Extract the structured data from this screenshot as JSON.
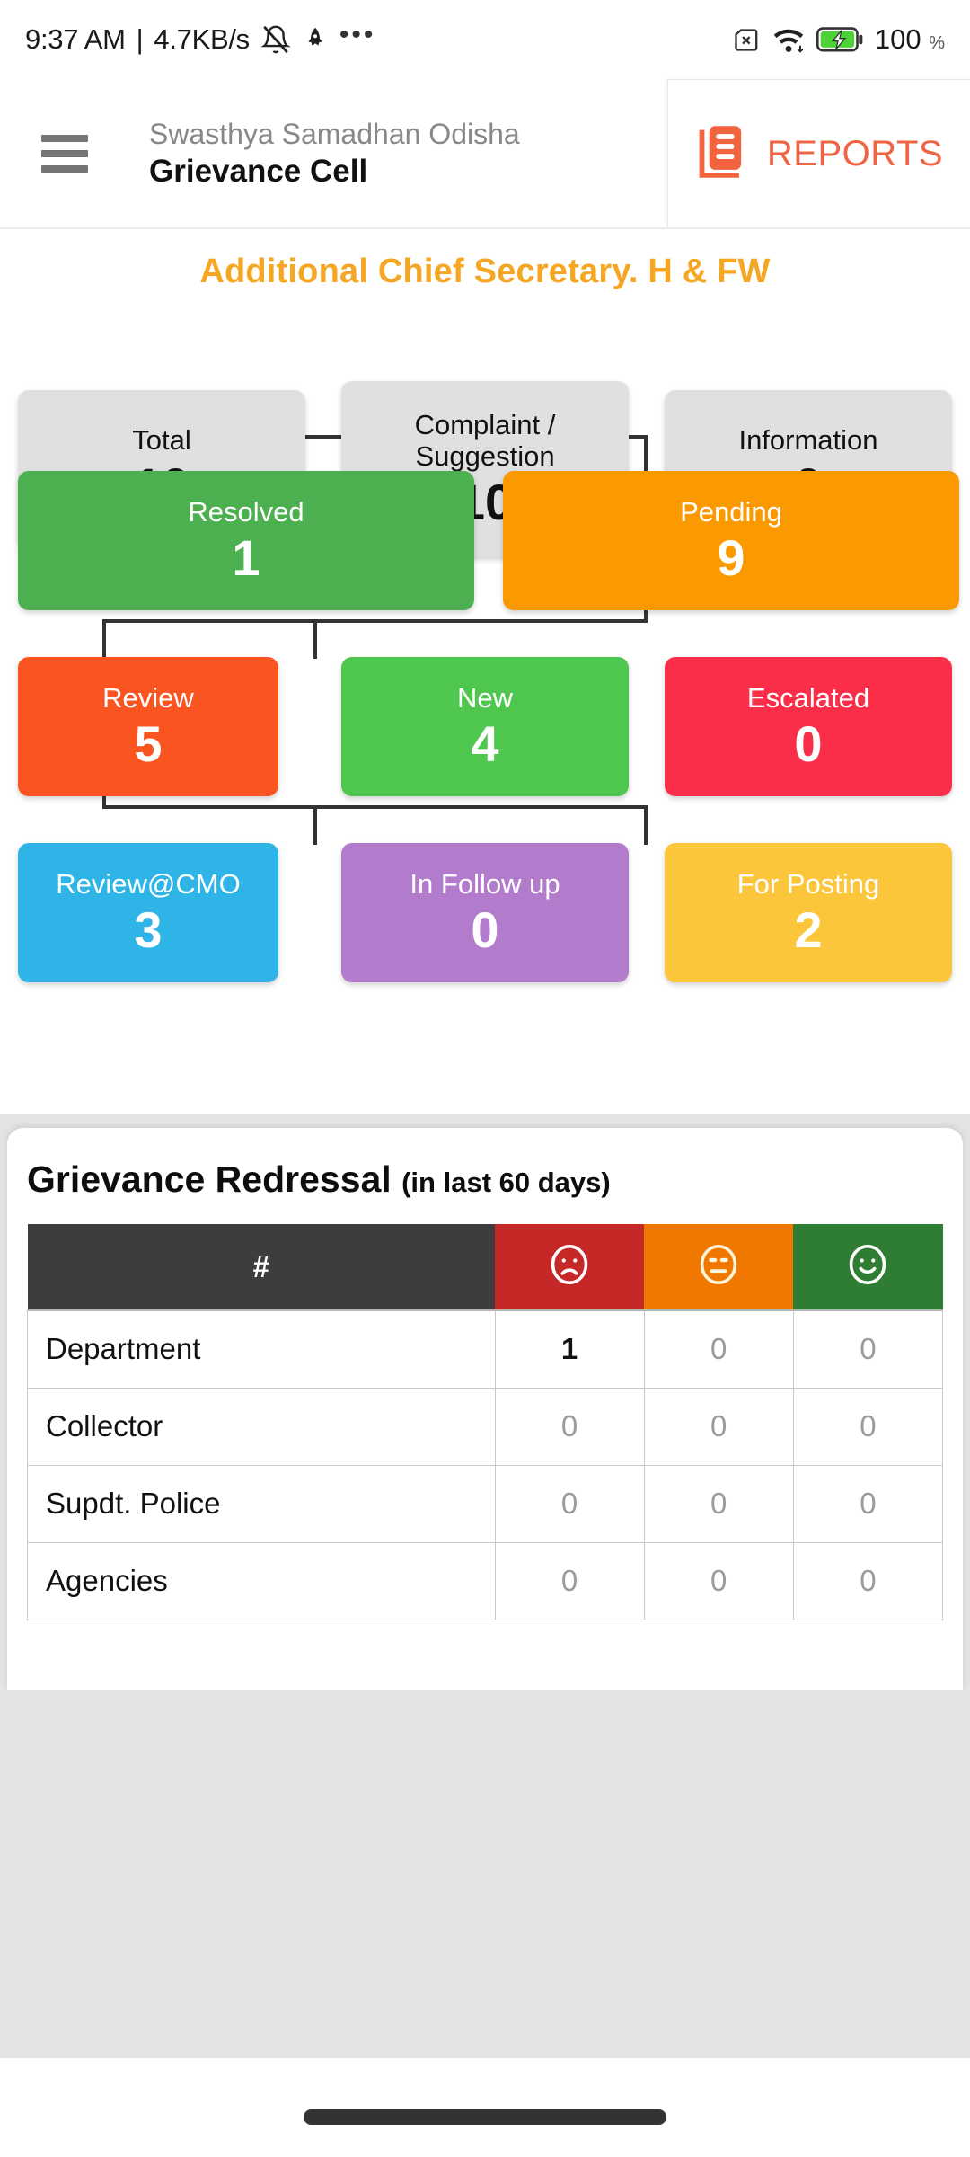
{
  "status_bar": {
    "time": "9:37 AM",
    "separator": "|",
    "network_speed": "4.7KB/s",
    "icons_left": [
      "bell-muted-icon",
      "rocket-icon",
      "more-dots-icon"
    ],
    "icons_right": [
      "no-sim-icon",
      "wifi-icon",
      "battery-charging-icon"
    ],
    "battery_percent": "100",
    "percent_symbol": "%"
  },
  "app_bar": {
    "menu_icon": "hamburger-menu-icon",
    "subtitle": "Swasthya Samadhan Odisha",
    "title": "Grievance Cell",
    "reports_label": "REPORTS",
    "reports_icon": "reports-document-icon",
    "accent_color": "#ef6544"
  },
  "dashboard": {
    "department_title": "Additional Chief Secretary. H & FW",
    "department_title_color": "#F5A623",
    "nodes": [
      {
        "id": "total",
        "label": "Total",
        "value": "10",
        "color": "#e0e0e0",
        "text_color": "#111111"
      },
      {
        "id": "complaint",
        "label": "Complaint / Suggestion",
        "value": "10",
        "color": "#e0e0e0",
        "text_color": "#111111"
      },
      {
        "id": "information",
        "label": "Information",
        "value": "0",
        "color": "#e0e0e0",
        "text_color": "#111111"
      },
      {
        "id": "resolved",
        "label": "Resolved",
        "value": "1",
        "color": "#4CAF50",
        "text_color": "#ffffff"
      },
      {
        "id": "pending",
        "label": "Pending",
        "value": "9",
        "color": "#FB9900",
        "text_color": "#ffffff"
      },
      {
        "id": "review",
        "label": "Review",
        "value": "5",
        "color": "#FA5520",
        "text_color": "#ffffff"
      },
      {
        "id": "new",
        "label": "New",
        "value": "4",
        "color": "#4FC74F",
        "text_color": "#ffffff"
      },
      {
        "id": "escalated",
        "label": "Escalated",
        "value": "0",
        "color": "#FB2E4A",
        "text_color": "#ffffff"
      },
      {
        "id": "review_cmo",
        "label": "Review@CMO",
        "value": "3",
        "color": "#2FB4E8",
        "text_color": "#ffffff"
      },
      {
        "id": "in_follow_up",
        "label": "In Follow up",
        "value": "0",
        "color": "#B27BCC",
        "text_color": "#ffffff"
      },
      {
        "id": "for_posting",
        "label": "For Posting",
        "value": "2",
        "color": "#FCC63C",
        "text_color": "#ffffff"
      }
    ]
  },
  "redressal": {
    "title": "Grievance Redressal",
    "subtitle": "(in last 60 days)",
    "columns": [
      {
        "key": "name",
        "label": "#",
        "icon": "hash-icon",
        "header_color": "#3d3d3d"
      },
      {
        "key": "unhappy",
        "label": "",
        "icon": "frowning-face-icon",
        "header_color": "#C62828"
      },
      {
        "key": "neutral",
        "label": "",
        "icon": "neutral-face-icon",
        "header_color": "#F07800"
      },
      {
        "key": "happy",
        "label": "",
        "icon": "smiling-face-icon",
        "header_color": "#2E7D32"
      }
    ],
    "rows": [
      {
        "name": "Department",
        "unhappy": "1",
        "neutral": "0",
        "happy": "0"
      },
      {
        "name": "Collector",
        "unhappy": "0",
        "neutral": "0",
        "happy": "0"
      },
      {
        "name": "Supdt. Police",
        "unhappy": "0",
        "neutral": "0",
        "happy": "0"
      },
      {
        "name": "Agencies",
        "unhappy": "0",
        "neutral": "0",
        "happy": "0"
      }
    ]
  },
  "navigation": {
    "gesture_pill": "home-gesture-pill"
  }
}
